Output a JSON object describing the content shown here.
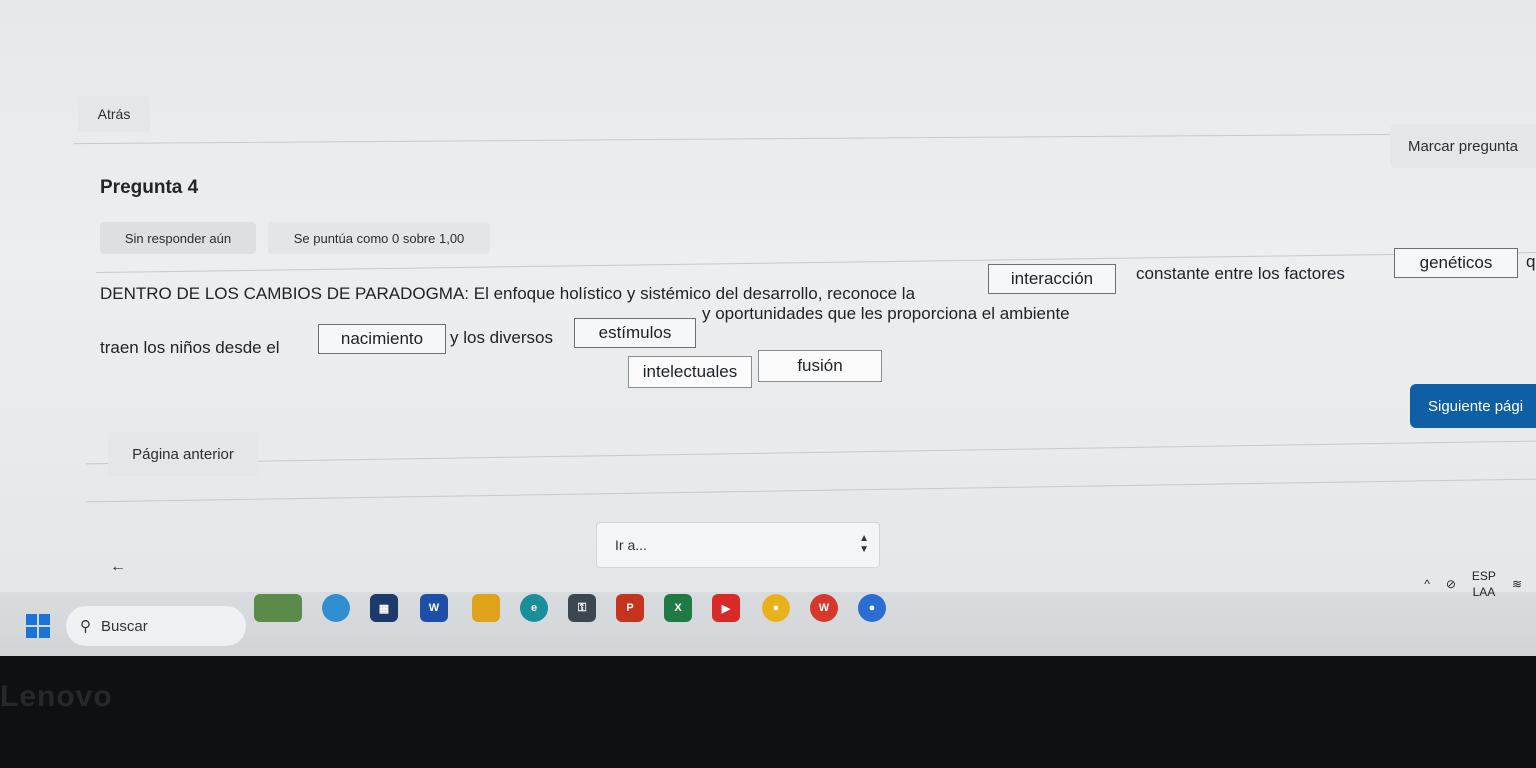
{
  "nav": {
    "back_label": "Atrás"
  },
  "question": {
    "title": "Pregunta 4",
    "mark_label": "Marcar pregunta",
    "status": "Sin responder aún",
    "score": "Se puntúa como 0 sobre 1,00",
    "text_line1_part1": "DENTRO DE LOS CAMBIOS DE PARADOGMA: El enfoque holístico y sistémico del desarrollo,  reconoce la",
    "text_line1_part2": "constante entre los factores",
    "text_line1_tail": "q",
    "text_line2_part1": "traen los niños desde el",
    "text_line2_part2": "y los diversos",
    "text_line2_part3": "y oportunidades que les proporciona el ambiente",
    "blanks": [
      "interacción",
      "genéticos",
      "nacimiento",
      "estímulos"
    ],
    "drag_options": [
      "intelectuales",
      "fusión"
    ]
  },
  "pager": {
    "next_label": "Siguiente pági",
    "prev_label": "Página anterior",
    "goto_label": "Ir a...",
    "back_arrow": "←"
  },
  "taskbar": {
    "search_label": "Buscar",
    "lang_top": "ESP",
    "lang_bottom": "LAA",
    "apps": [
      "widget",
      "copilot",
      "store",
      "word",
      "files",
      "edge",
      "keys",
      "powerpoint",
      "excel",
      "youtube",
      "chrome",
      "wps",
      "chrome-alt"
    ]
  },
  "bezel": {
    "brand": "Lenovo"
  },
  "colors": {
    "accent": "#0f5fa6",
    "background": "#eceeef"
  }
}
